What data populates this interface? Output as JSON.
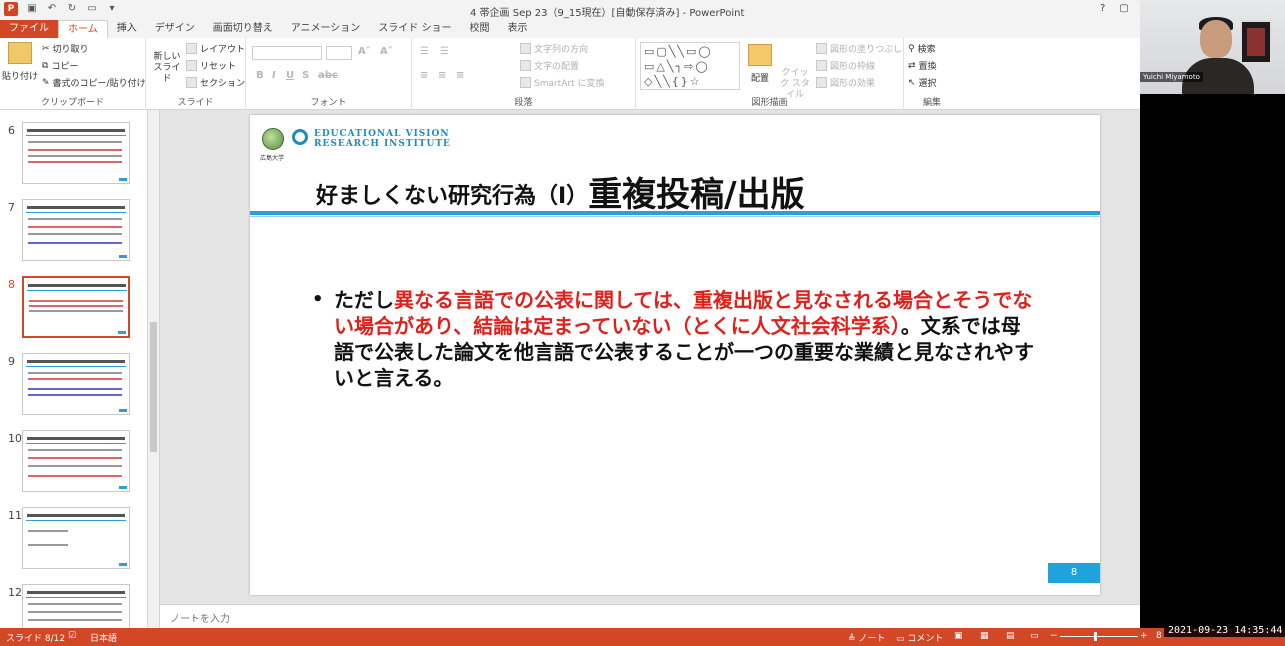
{
  "window": {
    "title": "4 帯企画 Sep 23（9_15現在）[自動保存済み] - PowerPoint",
    "help": "?",
    "restore": "▢"
  },
  "tabs": [
    "ファイル",
    "ホーム",
    "挿入",
    "デザイン",
    "画面切り替え",
    "アニメーション",
    "スライド ショー",
    "校閲",
    "表示"
  ],
  "ribbon": {
    "clipboard": {
      "paste": "貼り付け",
      "cut": "切り取り",
      "copy": "コピー",
      "format_painter": "書式のコピー/貼り付け",
      "label": "クリップボード"
    },
    "slides": {
      "new_slide": "新しい スライド",
      "layout": "レイアウト",
      "reset": "リセット",
      "section": "セクション",
      "label": "スライド"
    },
    "font": {
      "bold": "B",
      "italic": "I",
      "underline": "U",
      "shadow": "S",
      "strike": "abc",
      "label": "フォント"
    },
    "paragraph": {
      "text_direction": "文字列の方向",
      "align_text": "文字の配置",
      "smartart": "SmartArt に変換",
      "label": "段落"
    },
    "drawing": {
      "arrange": "配置",
      "quick_styles": "クイック スタイル",
      "shape_fill": "図形の塗りつぶし",
      "shape_outline": "図形の枠線",
      "shape_effects": "図形の効果",
      "label": "図形描画"
    },
    "editing": {
      "find": "検索",
      "replace": "置換",
      "select": "選択",
      "label": "編集"
    }
  },
  "slides_pane": {
    "items": [
      {
        "num": "6"
      },
      {
        "num": "7"
      },
      {
        "num": "8",
        "selected": true
      },
      {
        "num": "9"
      },
      {
        "num": "10"
      },
      {
        "num": "11"
      },
      {
        "num": "12"
      }
    ]
  },
  "slide": {
    "logo_line1": "EDUCATIONAL VISION",
    "logo_line2": "RESEARCH INSTITUTE",
    "logo_sub": "広島大学",
    "title_small": "好ましくない研究行為（Ⅰ）",
    "title_big": "重複投稿/出版",
    "bullet_dot": "•",
    "text_1": "ただし",
    "text_red": "異なる言語での公表に関しては、重複出版と見なされる場合とそうでない場合があり、結論は定まっていない（とくに人文社会科学系）",
    "text_2": "。文系では母語で公表した論文を他言語で公表することが一つの重要な業績と見なされやすいと言える。",
    "page_number": "8"
  },
  "notes": {
    "placeholder": "ノートを入力"
  },
  "statusbar": {
    "slide_info": "スライド 8/12",
    "language": "日本語",
    "notes_btn": "ノート",
    "comments_btn": "コメント",
    "zoom": "8"
  },
  "webcam": {
    "name": "Yuichi Miyamoto"
  },
  "timestamp": "2021-09-23  14:35:44"
}
